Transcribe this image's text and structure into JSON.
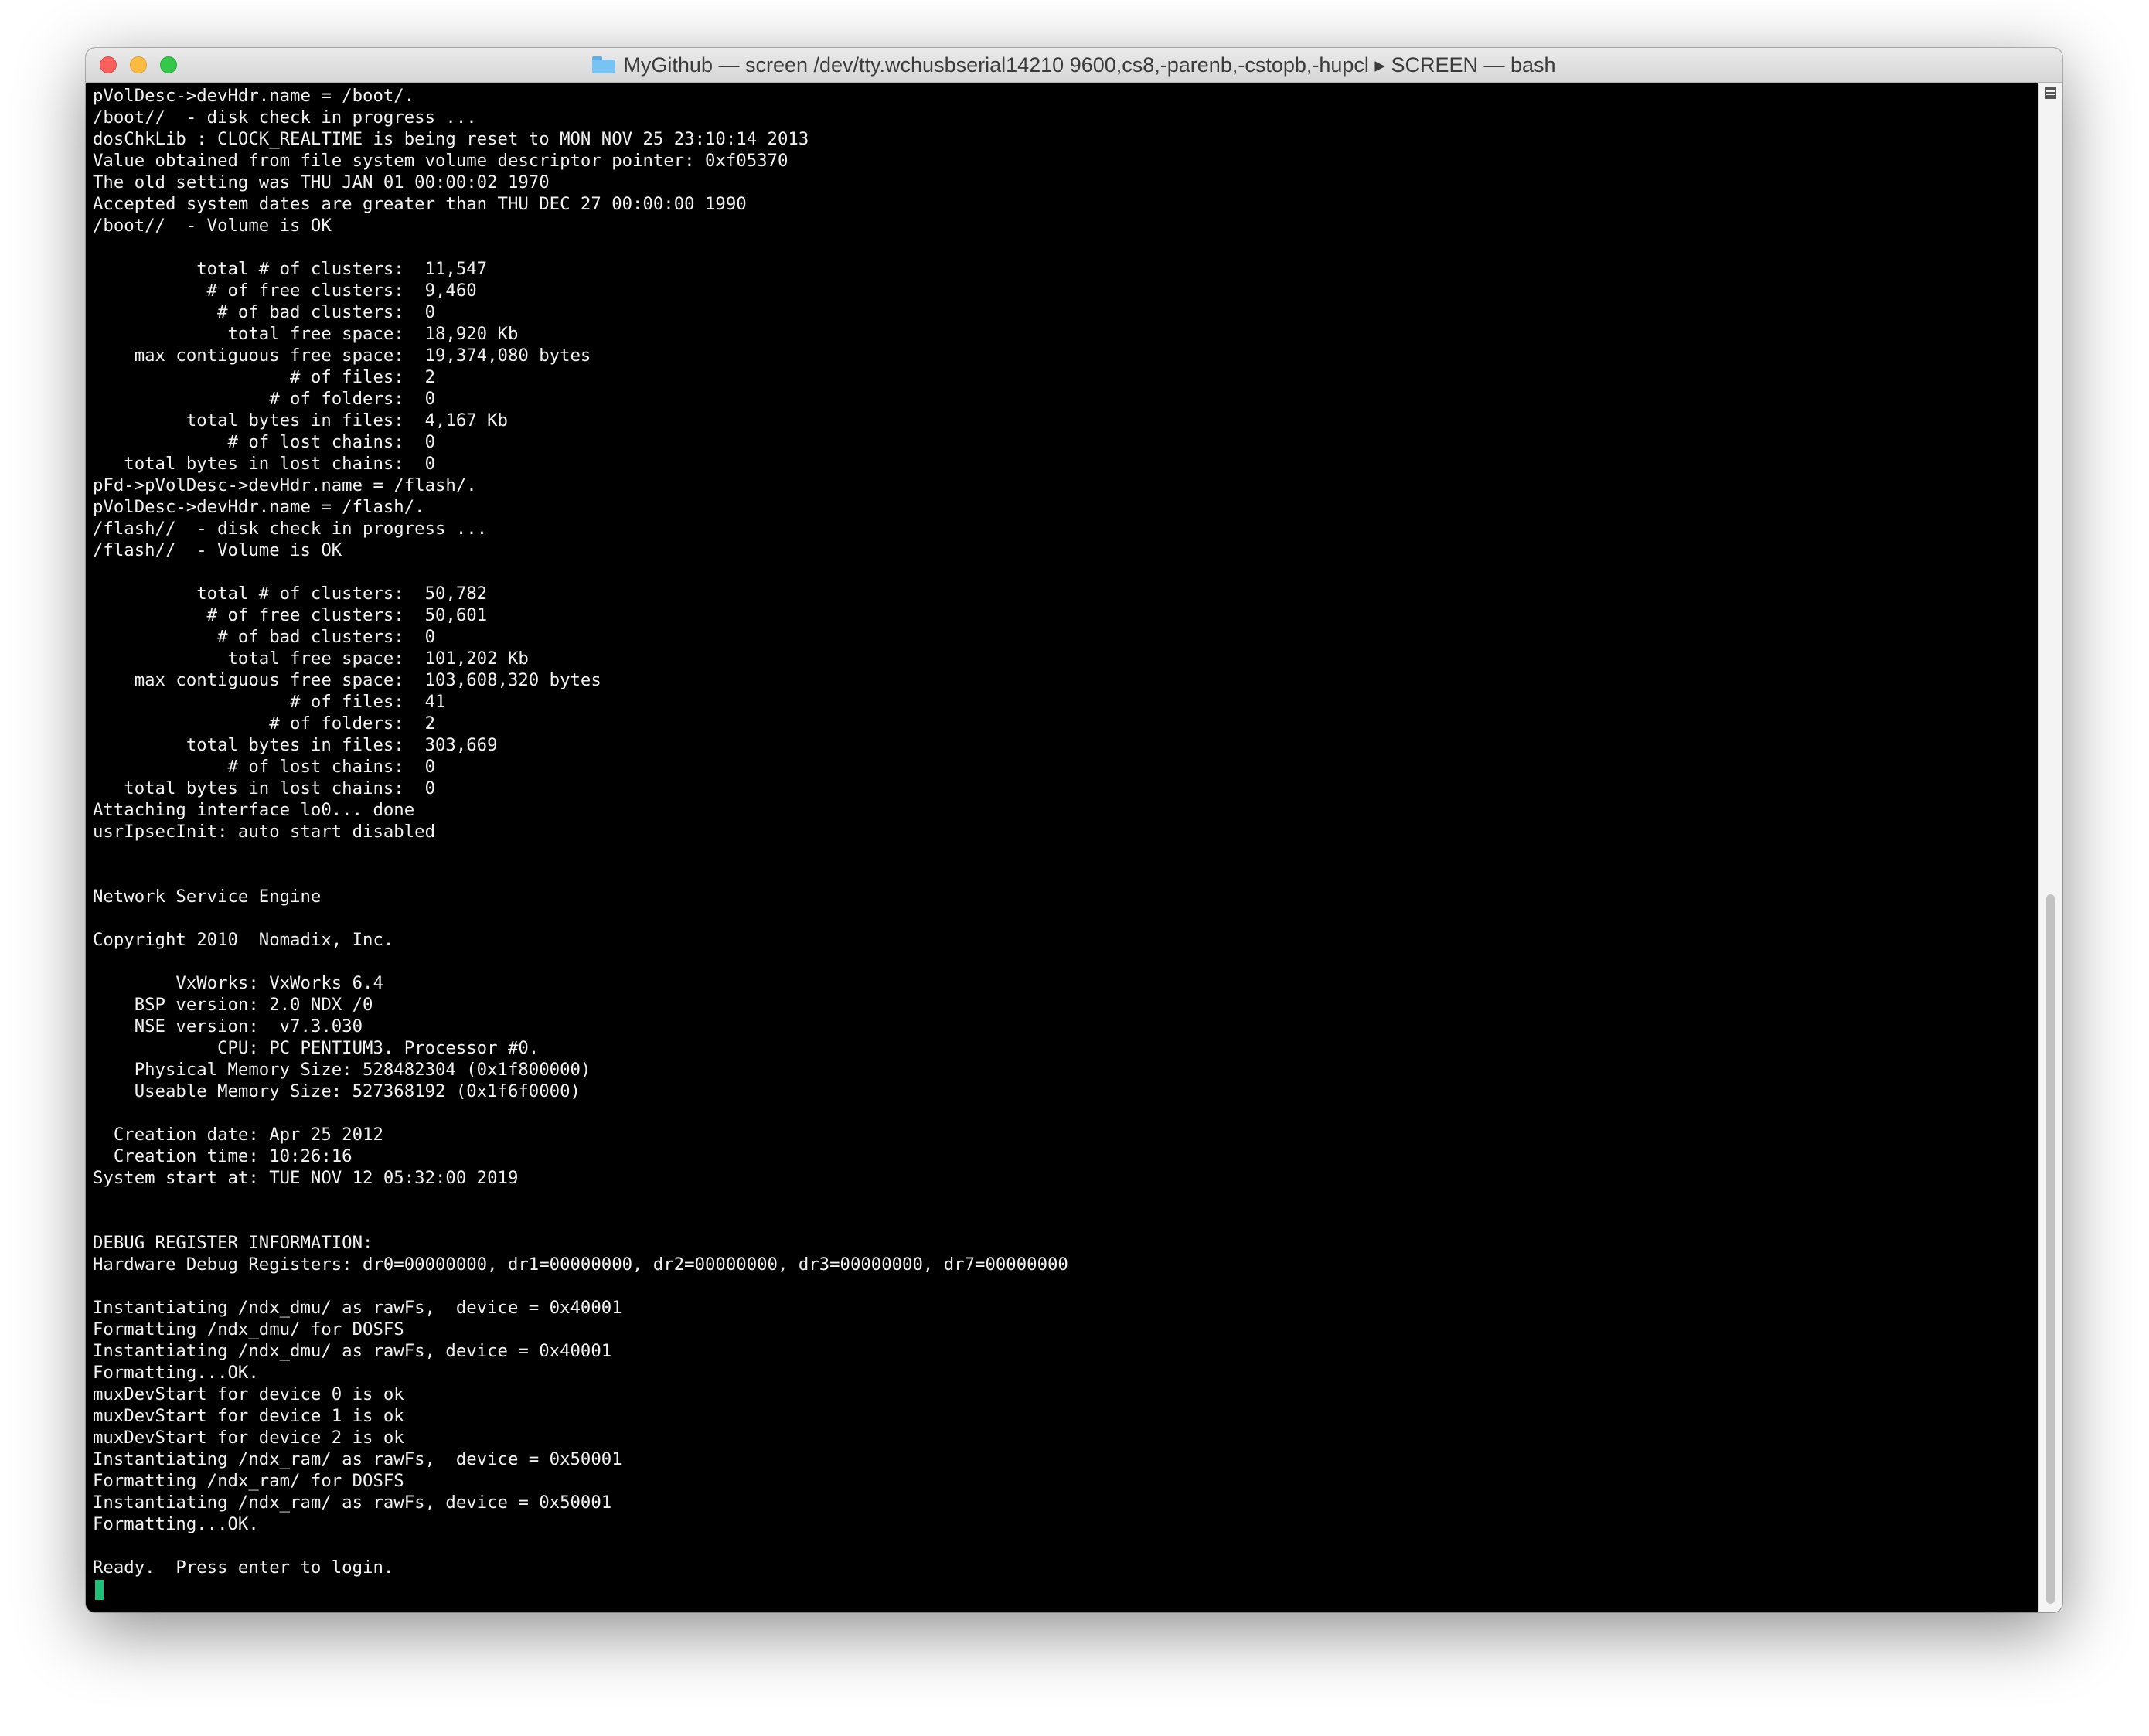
{
  "window": {
    "title": "MyGithub — screen /dev/tty.wchusbserial14210 9600,cs8,-parenb,-cstopb,-hupcl ▸ SCREEN — bash",
    "folder_icon": "folder-icon",
    "traffic_lights": [
      "close",
      "minimize",
      "zoom"
    ],
    "colors": {
      "close": "#fc605c",
      "minimize": "#fdbc40",
      "zoom": "#34c84a",
      "terminal_background": "#000000",
      "terminal_text": "#f2f2f2",
      "cursor": "#21c07a"
    }
  },
  "terminal": {
    "lines": [
      "pVolDesc->devHdr.name = /boot/.",
      "/boot//  - disk check in progress ...",
      "dosChkLib : CLOCK_REALTIME is being reset to MON NOV 25 23:10:14 2013",
      "Value obtained from file system volume descriptor pointer: 0xf05370",
      "The old setting was THU JAN 01 00:00:02 1970",
      "Accepted system dates are greater than THU DEC 27 00:00:00 1990",
      "/boot//  - Volume is OK",
      "",
      "          total # of clusters:  11,547",
      "           # of free clusters:  9,460",
      "            # of bad clusters:  0",
      "             total free space:  18,920 Kb",
      "    max contiguous free space:  19,374,080 bytes",
      "                   # of files:  2",
      "                 # of folders:  0",
      "         total bytes in files:  4,167 Kb",
      "             # of lost chains:  0",
      "   total bytes in lost chains:  0",
      "pFd->pVolDesc->devHdr.name = /flash/.",
      "pVolDesc->devHdr.name = /flash/.",
      "/flash//  - disk check in progress ...",
      "/flash//  - Volume is OK",
      "",
      "          total # of clusters:  50,782",
      "           # of free clusters:  50,601",
      "            # of bad clusters:  0",
      "             total free space:  101,202 Kb",
      "    max contiguous free space:  103,608,320 bytes",
      "                   # of files:  41",
      "                 # of folders:  2",
      "         total bytes in files:  303,669",
      "             # of lost chains:  0",
      "   total bytes in lost chains:  0",
      "Attaching interface lo0... done",
      "usrIpsecInit: auto start disabled",
      "",
      "",
      "Network Service Engine",
      "",
      "Copyright 2010  Nomadix, Inc.",
      "",
      "        VxWorks: VxWorks 6.4",
      "    BSP version: 2.0 NDX /0",
      "    NSE version:  v7.3.030",
      "            CPU: PC PENTIUM3. Processor #0.",
      "    Physical Memory Size: 528482304 (0x1f800000)",
      "    Useable Memory Size: 527368192 (0x1f6f0000)",
      "",
      "  Creation date: Apr 25 2012",
      "  Creation time: 10:26:16",
      "System start at: TUE NOV 12 05:32:00 2019",
      "",
      "",
      "DEBUG REGISTER INFORMATION:",
      "Hardware Debug Registers: dr0=00000000, dr1=00000000, dr2=00000000, dr3=00000000, dr7=00000000",
      "",
      "Instantiating /ndx_dmu/ as rawFs,  device = 0x40001",
      "Formatting /ndx_dmu/ for DOSFS",
      "Instantiating /ndx_dmu/ as rawFs, device = 0x40001",
      "Formatting...OK.",
      "muxDevStart for device 0 is ok",
      "muxDevStart for device 1 is ok",
      "muxDevStart for device 2 is ok",
      "Instantiating /ndx_ram/ as rawFs,  device = 0x50001",
      "Formatting /ndx_ram/ for DOSFS",
      "Instantiating /ndx_ram/ as rawFs, device = 0x50001",
      "Formatting...OK.",
      "",
      "Ready.  Press enter to login."
    ]
  }
}
